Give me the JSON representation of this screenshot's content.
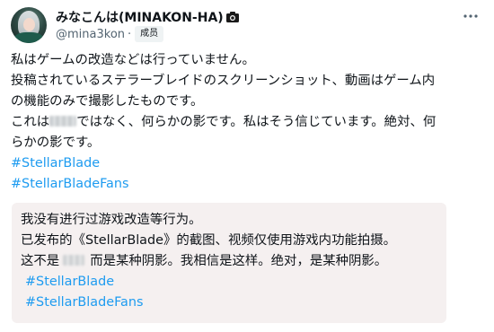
{
  "post": {
    "author": {
      "display_name": "みなこんは(MINAKON-HA)",
      "verified_icon": "camera-icon",
      "handle": "@mina3kon",
      "separator": "·",
      "badge": "成员"
    },
    "more_icon": "more-horizontal-icon",
    "body": {
      "line1": "私はゲームの改造などは行っていません。",
      "line2": "投稿されているステラーブレイドのスクリーンショット、動画はゲーム内",
      "line3": "の機能のみで撮影したものです。",
      "line4_before": "これは",
      "line4_after": "ではなく、何らかの影です。私はそう信じています。絶対、何",
      "line5": "らかの影です。",
      "hashtag1": "#StellarBlade",
      "hashtag2": "#StellarBladeFans"
    },
    "translation": {
      "line1": "我没有进行过游戏改造等行为。",
      "line2": "已发布的《StellarBlade》的截图、视频仅使用游戏内功能拍摄。",
      "line3_before": "这不是",
      "line3_after": "而是某种阴影。我相信是这样。绝对，是某种阴影。",
      "hashtag1": "#StellarBlade",
      "hashtag2": "#StellarBladeFans"
    },
    "colors": {
      "link": "#1d9bf0",
      "secondary_text": "#536471",
      "translation_bg": "#f5f0f0"
    }
  }
}
